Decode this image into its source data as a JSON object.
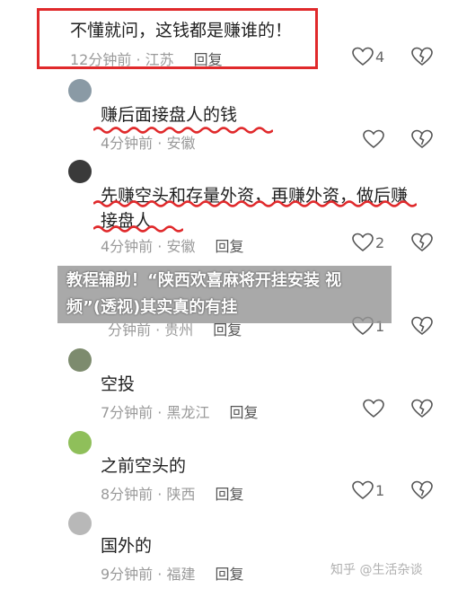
{
  "comments": [
    {
      "text": "不懂就问，这钱都是赚谁的！",
      "time": "12分钟前 · 江苏",
      "reply": "回复",
      "like_count": "4",
      "user": ""
    },
    {
      "text": "赚后面接盘人的钱",
      "time": "4分钟前 · 安徽",
      "reply": "回复",
      "like_count": "",
      "user": ""
    },
    {
      "text": "先赚空头和存量外资，再赚外资，做后赚接盘人",
      "time": "4分钟前 · 安徽",
      "reply": "回复",
      "like_count": "2",
      "user": ""
    },
    {
      "text": "",
      "time": "分钟前 · 贵州",
      "reply": "回复",
      "like_count": "1",
      "user": ""
    },
    {
      "text": "空投",
      "time": "7分钟前 · 黑龙江",
      "reply": "回复",
      "like_count": "",
      "user": ""
    },
    {
      "text": "之前空头的",
      "time": "8分钟前 · 陕西",
      "reply": "回复",
      "like_count": "1",
      "user": ""
    },
    {
      "text": "国外的",
      "time": "9分钟前 · 福建",
      "reply": "回复",
      "like_count": "",
      "user": ""
    }
  ],
  "banner": {
    "text": "教程辅助！“陕西欢喜麻将开挂安装 视频”(透视)其实真的有挂"
  },
  "watermark": {
    "text": "知乎 @生活杂谈"
  },
  "icons": {
    "like": "heart-icon",
    "dislike": "broken-heart-icon"
  },
  "colors": {
    "highlight": "#e0292b",
    "banner_bg": "#969696"
  }
}
